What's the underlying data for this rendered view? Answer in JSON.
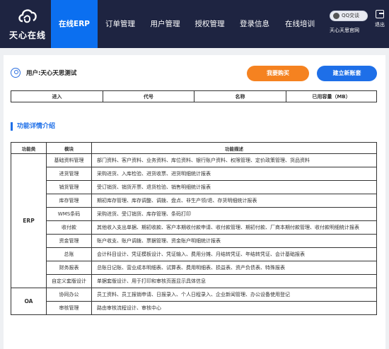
{
  "header": {
    "logo_text": "天心在线",
    "nav": [
      "在线ERP",
      "订单管理",
      "用户管理",
      "授权管理",
      "登录信息",
      "在线培训"
    ],
    "active_index": 0,
    "qq_label": "QQ交谈",
    "site_link": "天心天思官网",
    "exit_label": "退出"
  },
  "user": {
    "label": "用户:天心天思测试"
  },
  "buttons": {
    "buy": "我要购买",
    "new_account": "建立新账套"
  },
  "accounts_table": {
    "columns": [
      "进入",
      "代号",
      "名称",
      "已用容量（MB）"
    ]
  },
  "section_title": "功能详情介绍",
  "func_table": {
    "columns": [
      "功能类",
      "模块",
      "功能描述"
    ],
    "groups": [
      {
        "category": "ERP",
        "rows": [
          {
            "module": "基础资料管理",
            "desc": "部门资料、客户资料、业务资料、库位资料、银行账户资料、权限管理、定价政策管理、货品资料"
          },
          {
            "module": "进货管理",
            "desc": "采购进货、入库检验、进货收票、进货明细统计报表"
          },
          {
            "module": "销货管理",
            "desc": "受订销货、销货开票、退货检验、销售明细统计报表"
          },
          {
            "module": "库存管理",
            "desc": "期初库存管理、库存调整、调拨、盘点、非生产领/退、存货明细统计报表"
          },
          {
            "module": "WMS条码",
            "desc": "采购进货、受订销货、库存管理、条码打印"
          },
          {
            "module": "收付款",
            "desc": "其他收入支出单据、期初收款、客户本期收付款申请、收付款管理、期初付款、厂商本期付款管理、收付款明细统计报表"
          },
          {
            "module": "资金管理",
            "desc": "账户收支、账户调拨、票据管理、资金账户明细统计报表"
          },
          {
            "module": "总账",
            "desc": "会计科目设计、凭证模板设计、凭证输入、费用分摊、月结转凭证、年结转凭证、会计基础报表"
          },
          {
            "module": "财务报表",
            "desc": "总账日记账、营业成本明细表、试算表、费用明细表、损益表、资产负债表、特殊报表"
          },
          {
            "module": "自定义套版设计",
            "desc": "单据套版设计、用于打印和审核页面显示具体信息"
          }
        ]
      },
      {
        "category": "OA",
        "rows": [
          {
            "module": "协同办公",
            "desc": "员工资料、员工报销申请、日报录入、个人日程录入、企业新闻管理、办公设备使用登记"
          },
          {
            "module": "审核管理",
            "desc": "路由审核流程设计、审核中心"
          }
        ]
      }
    ]
  },
  "colors": {
    "header_bg": "#1e2441",
    "nav_active": "#0b6ff0",
    "buy": "#f58220",
    "new": "#1e6fe8"
  }
}
